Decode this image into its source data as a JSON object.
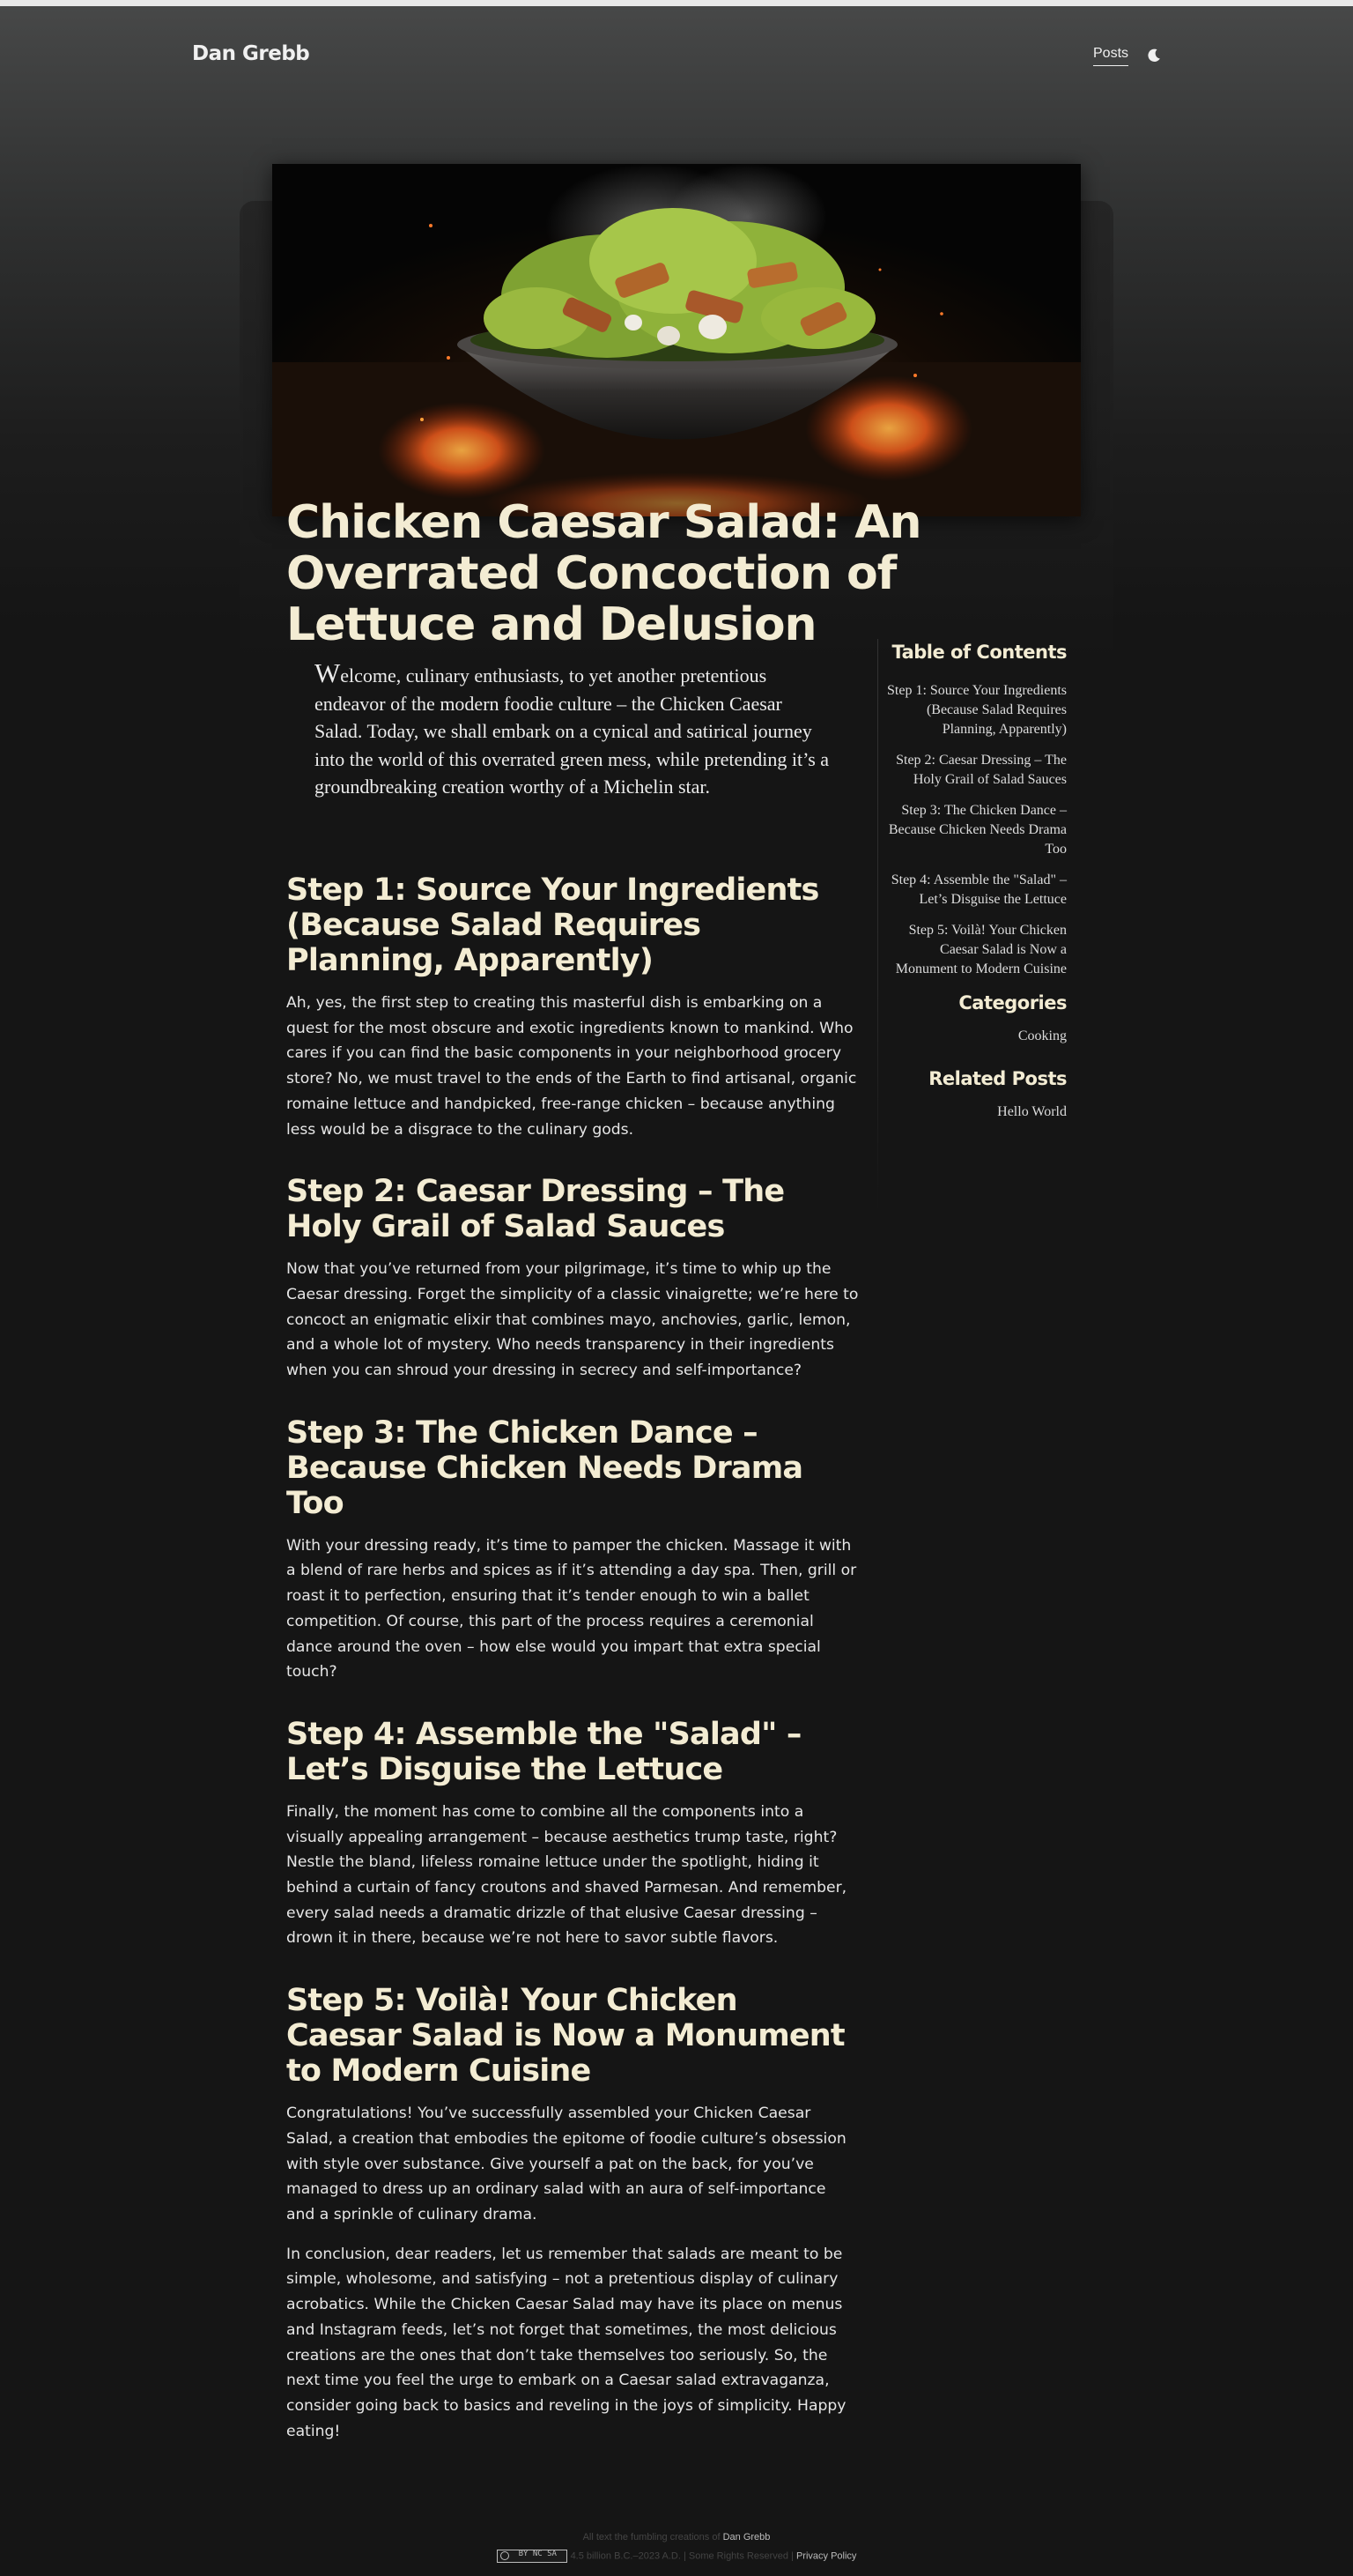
{
  "header": {
    "site_title": "Dan Grebb",
    "nav_posts": "Posts",
    "theme_toggle_icon": "moon-icon"
  },
  "hero": {
    "image_icon": "caesar-salad-bowl-image"
  },
  "post": {
    "title": "Chicken Caesar Salad: An Overrated Concoction of Lettuce and Delusion",
    "intro_dropcap": "W",
    "intro_rest": "elcome, culinary enthusiasts, to yet another pretentious endeavor of the modern foodie culture – the Chicken Caesar Salad. Today, we shall embark on a cynical and satirical journey into the world of this overrated green mess, while pretending it’s a groundbreaking creation worthy of a Michelin star.",
    "sections": [
      {
        "heading": "Step 1: Source Your Ingredients (Because Salad Requires Planning, Apparently)",
        "paragraphs": [
          "Ah, yes, the first step to creating this masterful dish is embarking on a quest for the most obscure and exotic ingredients known to mankind. Who cares if you can find the basic components in your neighborhood grocery store? No, we must travel to the ends of the Earth to find artisanal, organic romaine lettuce and handpicked, free-range chicken – because anything less would be a disgrace to the culinary gods."
        ]
      },
      {
        "heading": "Step 2: Caesar Dressing – The Holy Grail of Salad Sauces",
        "paragraphs": [
          "Now that you’ve returned from your pilgrimage, it’s time to whip up the Caesar dressing. Forget the simplicity of a classic vinaigrette; we’re here to concoct an enigmatic elixir that combines mayo, anchovies, garlic, lemon, and a whole lot of mystery. Who needs transparency in their ingredients when you can shroud your dressing in secrecy and self-importance?"
        ]
      },
      {
        "heading": "Step 3: The Chicken Dance – Because Chicken Needs Drama Too",
        "paragraphs": [
          "With your dressing ready, it’s time to pamper the chicken. Massage it with a blend of rare herbs and spices as if it’s attending a day spa. Then, grill or roast it to perfection, ensuring that it’s tender enough to win a ballet competition. Of course, this part of the process requires a ceremonial dance around the oven – how else would you impart that extra special touch?"
        ]
      },
      {
        "heading": "Step 4: Assemble the \"Salad\" – Let’s Disguise the Lettuce",
        "paragraphs": [
          "Finally, the moment has come to combine all the components into a visually appealing arrangement – because aesthetics trump taste, right? Nestle the bland, lifeless romaine lettuce under the spotlight, hiding it behind a curtain of fancy croutons and shaved Parmesan. And remember, every salad needs a dramatic drizzle of that elusive Caesar dressing – drown it in there, because we’re not here to savor subtle flavors."
        ]
      },
      {
        "heading": "Step 5: Voilà! Your Chicken Caesar Salad is Now a Monument to Modern Cuisine",
        "paragraphs": [
          "Congratulations! You’ve successfully assembled your Chicken Caesar Salad, a creation that embodies the epitome of foodie culture’s obsession with style over substance. Give yourself a pat on the back, for you’ve managed to dress up an ordinary salad with an aura of self-importance and a sprinkle of culinary drama.",
          "In conclusion, dear readers, let us remember that salads are meant to be simple, wholesome, and satisfying – not a pretentious display of culinary acrobatics. While the Chicken Caesar Salad may have its place on menus and Instagram feeds, let’s not forget that sometimes, the most delicious creations are the ones that don’t take themselves too seriously. So, the next time you feel the urge to embark on a Caesar salad extravaganza, consider going back to basics and reveling in the joys of simplicity. Happy eating!"
        ]
      }
    ]
  },
  "sidebar": {
    "toc_title": "Table of Contents",
    "toc_items": [
      "Step 1: Source Your Ingredients (Because Salad Requires Planning, Apparently)",
      "Step 2: Caesar Dressing – The Holy Grail of Salad Sauces",
      "Step 3: The Chicken Dance – Because Chicken Needs Drama Too",
      "Step 4: Assemble the \"Salad\" – Let’s Disguise the Lettuce",
      "Step 5: Voilà! Your Chicken Caesar Salad is Now a Monument to Modern Cuisine"
    ],
    "categories_title": "Categories",
    "categories": [
      "Cooking"
    ],
    "related_title": "Related Posts",
    "related": [
      "Hello World"
    ]
  },
  "footer": {
    "line1_prefix": "All text the fumbling creations of",
    "line1_author": "Dan Grebb",
    "badge_icon": "creative-commons-badge",
    "badge_text": "BY NC SA",
    "line2_text": "4.5 billion B.C.–2023 A.D. | Some Rights Reserved |",
    "privacy_link": "Privacy Policy"
  },
  "colors": {
    "background": "#151515",
    "heading": "#f3ecd3",
    "body_text": "#e6e6e6"
  }
}
